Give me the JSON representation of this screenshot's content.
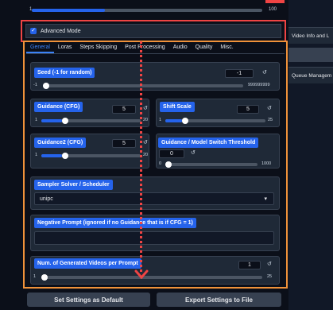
{
  "top_slider": {
    "min": "1",
    "max": "100"
  },
  "right_panel": {
    "items": [
      "Video Info and L",
      "Queue Managem"
    ]
  },
  "advanced_mode": {
    "label": "Advanced Mode",
    "checked": true,
    "check_glyph": "✓"
  },
  "tabs": [
    "General",
    "Loras",
    "Steps Skipping",
    "Post Processing",
    "Audio",
    "Quality",
    "Misc."
  ],
  "active_tab": "General",
  "seed": {
    "label": "Seed (-1 for random)",
    "value": "-1",
    "min": "-1",
    "max": "999999999"
  },
  "guidance": {
    "label": "Guidance (CFG)",
    "value": "5",
    "min": "1",
    "max": "20",
    "fraction": 0.21
  },
  "shift_scale": {
    "label": "Shift Scale",
    "value": "5",
    "min": "1",
    "max": "25",
    "fraction": 0.17
  },
  "guidance2": {
    "label": "Guidance2 (CFG)",
    "value": "5",
    "min": "1",
    "max": "20",
    "fraction": 0.21
  },
  "switch_threshold": {
    "label": "Guidance / Model Switch Threshold",
    "value": "0",
    "min": "0",
    "max": "1000",
    "fraction": 0.0
  },
  "sampler": {
    "label": "Sampler Solver / Scheduler",
    "value": "unipc"
  },
  "negative_prompt": {
    "label": "Negative Prompt (ignored if no Guidance that is if CFG = 1)",
    "value": ""
  },
  "num_videos": {
    "label": "Num. of Generated Videos per Prompt",
    "value": "1",
    "min": "1",
    "max": "25",
    "fraction": 0.0
  },
  "reset_glyph": "↺",
  "dropdown_glyph": "▾",
  "buttons": {
    "default": "Set Settings as Default",
    "export": "Export Settings to File"
  },
  "colors": {
    "accent": "#2563eb",
    "highlight_red": "#ef4444",
    "highlight_orange": "#f0923a"
  }
}
